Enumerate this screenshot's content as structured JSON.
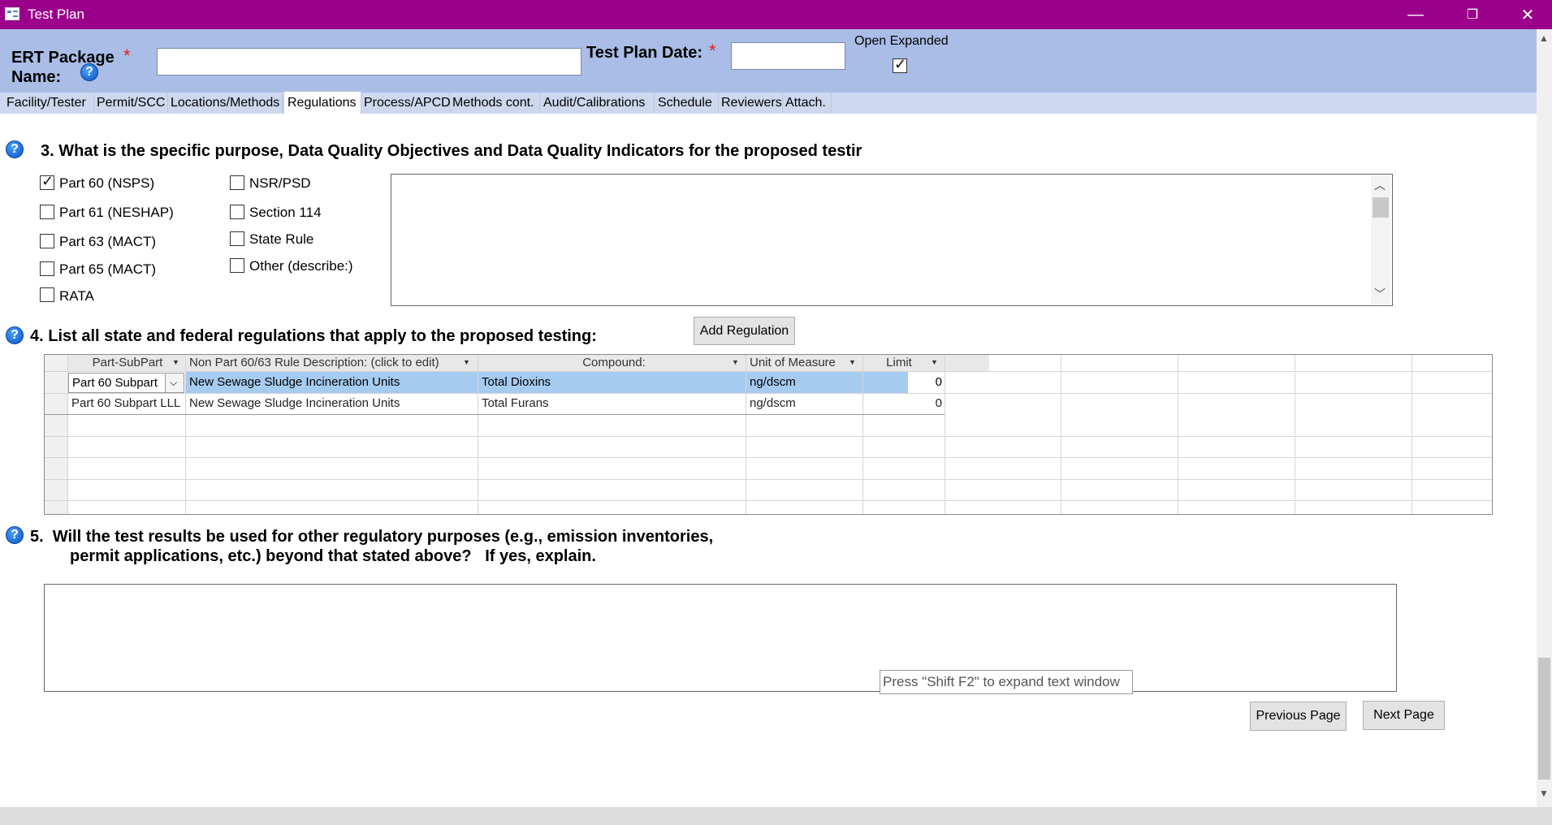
{
  "window": {
    "title": "Test Plan",
    "controls": {
      "minimize": "—",
      "restore": "❐",
      "close": "✕"
    }
  },
  "header": {
    "ert_label_line1": "ERT Package",
    "ert_label_line2": "Name:",
    "ert_value": "",
    "required_mark": "*",
    "date_label": "Test Plan Date:",
    "date_value": "",
    "open_expanded_label": "Open Expanded",
    "open_expanded_checked": true,
    "help_glyph": "?"
  },
  "tabs": [
    {
      "label": "Facility/Tester"
    },
    {
      "label": "Permit/SCC"
    },
    {
      "label": "Locations/Methods"
    },
    {
      "label": "Regulations",
      "active": true
    },
    {
      "label": "Process/APCD"
    },
    {
      "label": "Methods cont."
    },
    {
      "label": "Audit/Calibrations"
    },
    {
      "label": "Schedule"
    },
    {
      "label": "Reviewers"
    },
    {
      "label": "Attach."
    }
  ],
  "q3": {
    "text": "3.  What is the specific purpose, Data Quality Objectives and Data Quality Indicators for the proposed testir",
    "checkboxes_col1": [
      {
        "label": "Part 60 (NSPS)",
        "checked": true
      },
      {
        "label": "Part 61 (NESHAP)",
        "checked": false
      },
      {
        "label": "Part 63 (MACT)",
        "checked": false
      },
      {
        "label": "Part 65 (MACT)",
        "checked": false
      },
      {
        "label": "RATA",
        "checked": false
      }
    ],
    "checkboxes_col2": [
      {
        "label": "NSR/PSD",
        "checked": false
      },
      {
        "label": "Section 114",
        "checked": false
      },
      {
        "label": "State Rule",
        "checked": false
      },
      {
        "label": "Other (describe:)",
        "checked": false
      }
    ],
    "memo_value": ""
  },
  "q4": {
    "text": "4.  List all state and federal regulations that apply to the proposed testing:",
    "add_button": "Add Regulation",
    "columns": [
      "Part-SubPart",
      "Non Part 60/63 Rule Description: (click to edit)",
      "Compound:",
      "Unit of Measure",
      "Limit"
    ],
    "rows": [
      {
        "part": "Part 60 Subpart",
        "desc": "New Sewage Sludge Incineration Units",
        "compound": "Total Dioxins",
        "unit": "ng/dscm",
        "limit": "0",
        "selected": true
      },
      {
        "part": "Part 60 Subpart LLL",
        "desc": "New Sewage Sludge Incineration Units",
        "compound": "Total Furans",
        "unit": "ng/dscm",
        "limit": "0",
        "selected": false
      }
    ]
  },
  "q5": {
    "line1": "5.  Will the test results be used for other regulatory purposes (e.g., emission inventories,",
    "line2": "permit applications, etc.) beyond that stated above?   If yes, explain.",
    "memo_value": "",
    "hint": "Press \"Shift F2\" to expand text window"
  },
  "footer": {
    "previous": "Previous Page",
    "next": "Next Page"
  }
}
